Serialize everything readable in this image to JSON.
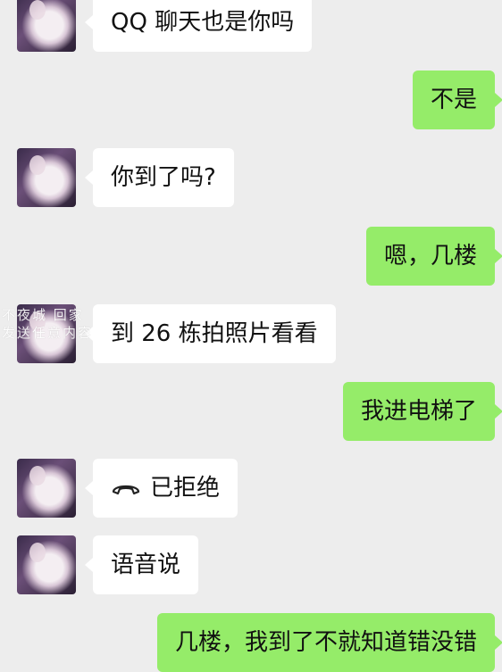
{
  "messages": [
    {
      "side": "left",
      "text": "QQ 聊天也是你吗"
    },
    {
      "side": "right",
      "text": "不是"
    },
    {
      "side": "left",
      "text": "你到了吗?"
    },
    {
      "side": "right",
      "text": "嗯，几楼"
    },
    {
      "side": "left",
      "text": "到 26 栋拍照片看看"
    },
    {
      "side": "right",
      "text": "我进电梯了"
    },
    {
      "side": "left",
      "text": "已拒绝",
      "icon": "phone-declined-icon"
    },
    {
      "side": "left",
      "text": "语音说"
    },
    {
      "side": "right",
      "text": "几楼，我到了不就知道错没错"
    }
  ],
  "watermark": {
    "line1": "不夜城 回家",
    "line2": "发送任意内容"
  },
  "colors": {
    "background": "#ededed",
    "incoming_bubble": "#ffffff",
    "outgoing_bubble": "#95ec69"
  }
}
